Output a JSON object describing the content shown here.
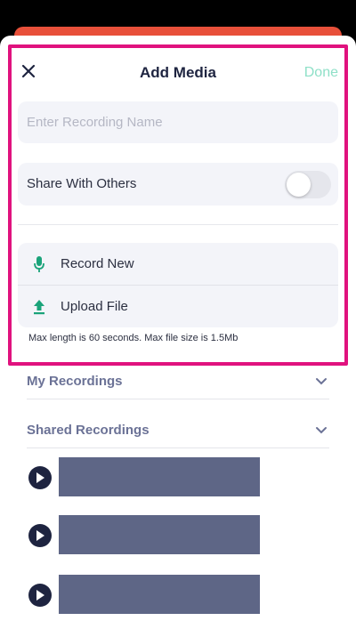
{
  "header": {
    "close_icon": "close-icon",
    "title": "Add Media",
    "done_label": "Done"
  },
  "form": {
    "name_placeholder": "Enter Recording Name",
    "name_value": "",
    "share_label": "Share With Others",
    "share_enabled": false
  },
  "actions": [
    {
      "label": "Record New",
      "icon": "microphone-icon"
    },
    {
      "label": "Upload File",
      "icon": "upload-icon"
    }
  ],
  "hint": "Max length is 60 seconds. Max file size is 1.5Mb",
  "sections": [
    {
      "title": "My Recordings",
      "icon": "chevron-down-icon"
    },
    {
      "title": "Shared Recordings",
      "icon": "chevron-down-icon"
    }
  ],
  "colors": {
    "accent_green": "#1aa37a",
    "done_disabled": "#8fe0c8",
    "highlight_border": "#e0127e",
    "navy": "#1e2440",
    "recording_bar": "#5e6686"
  }
}
